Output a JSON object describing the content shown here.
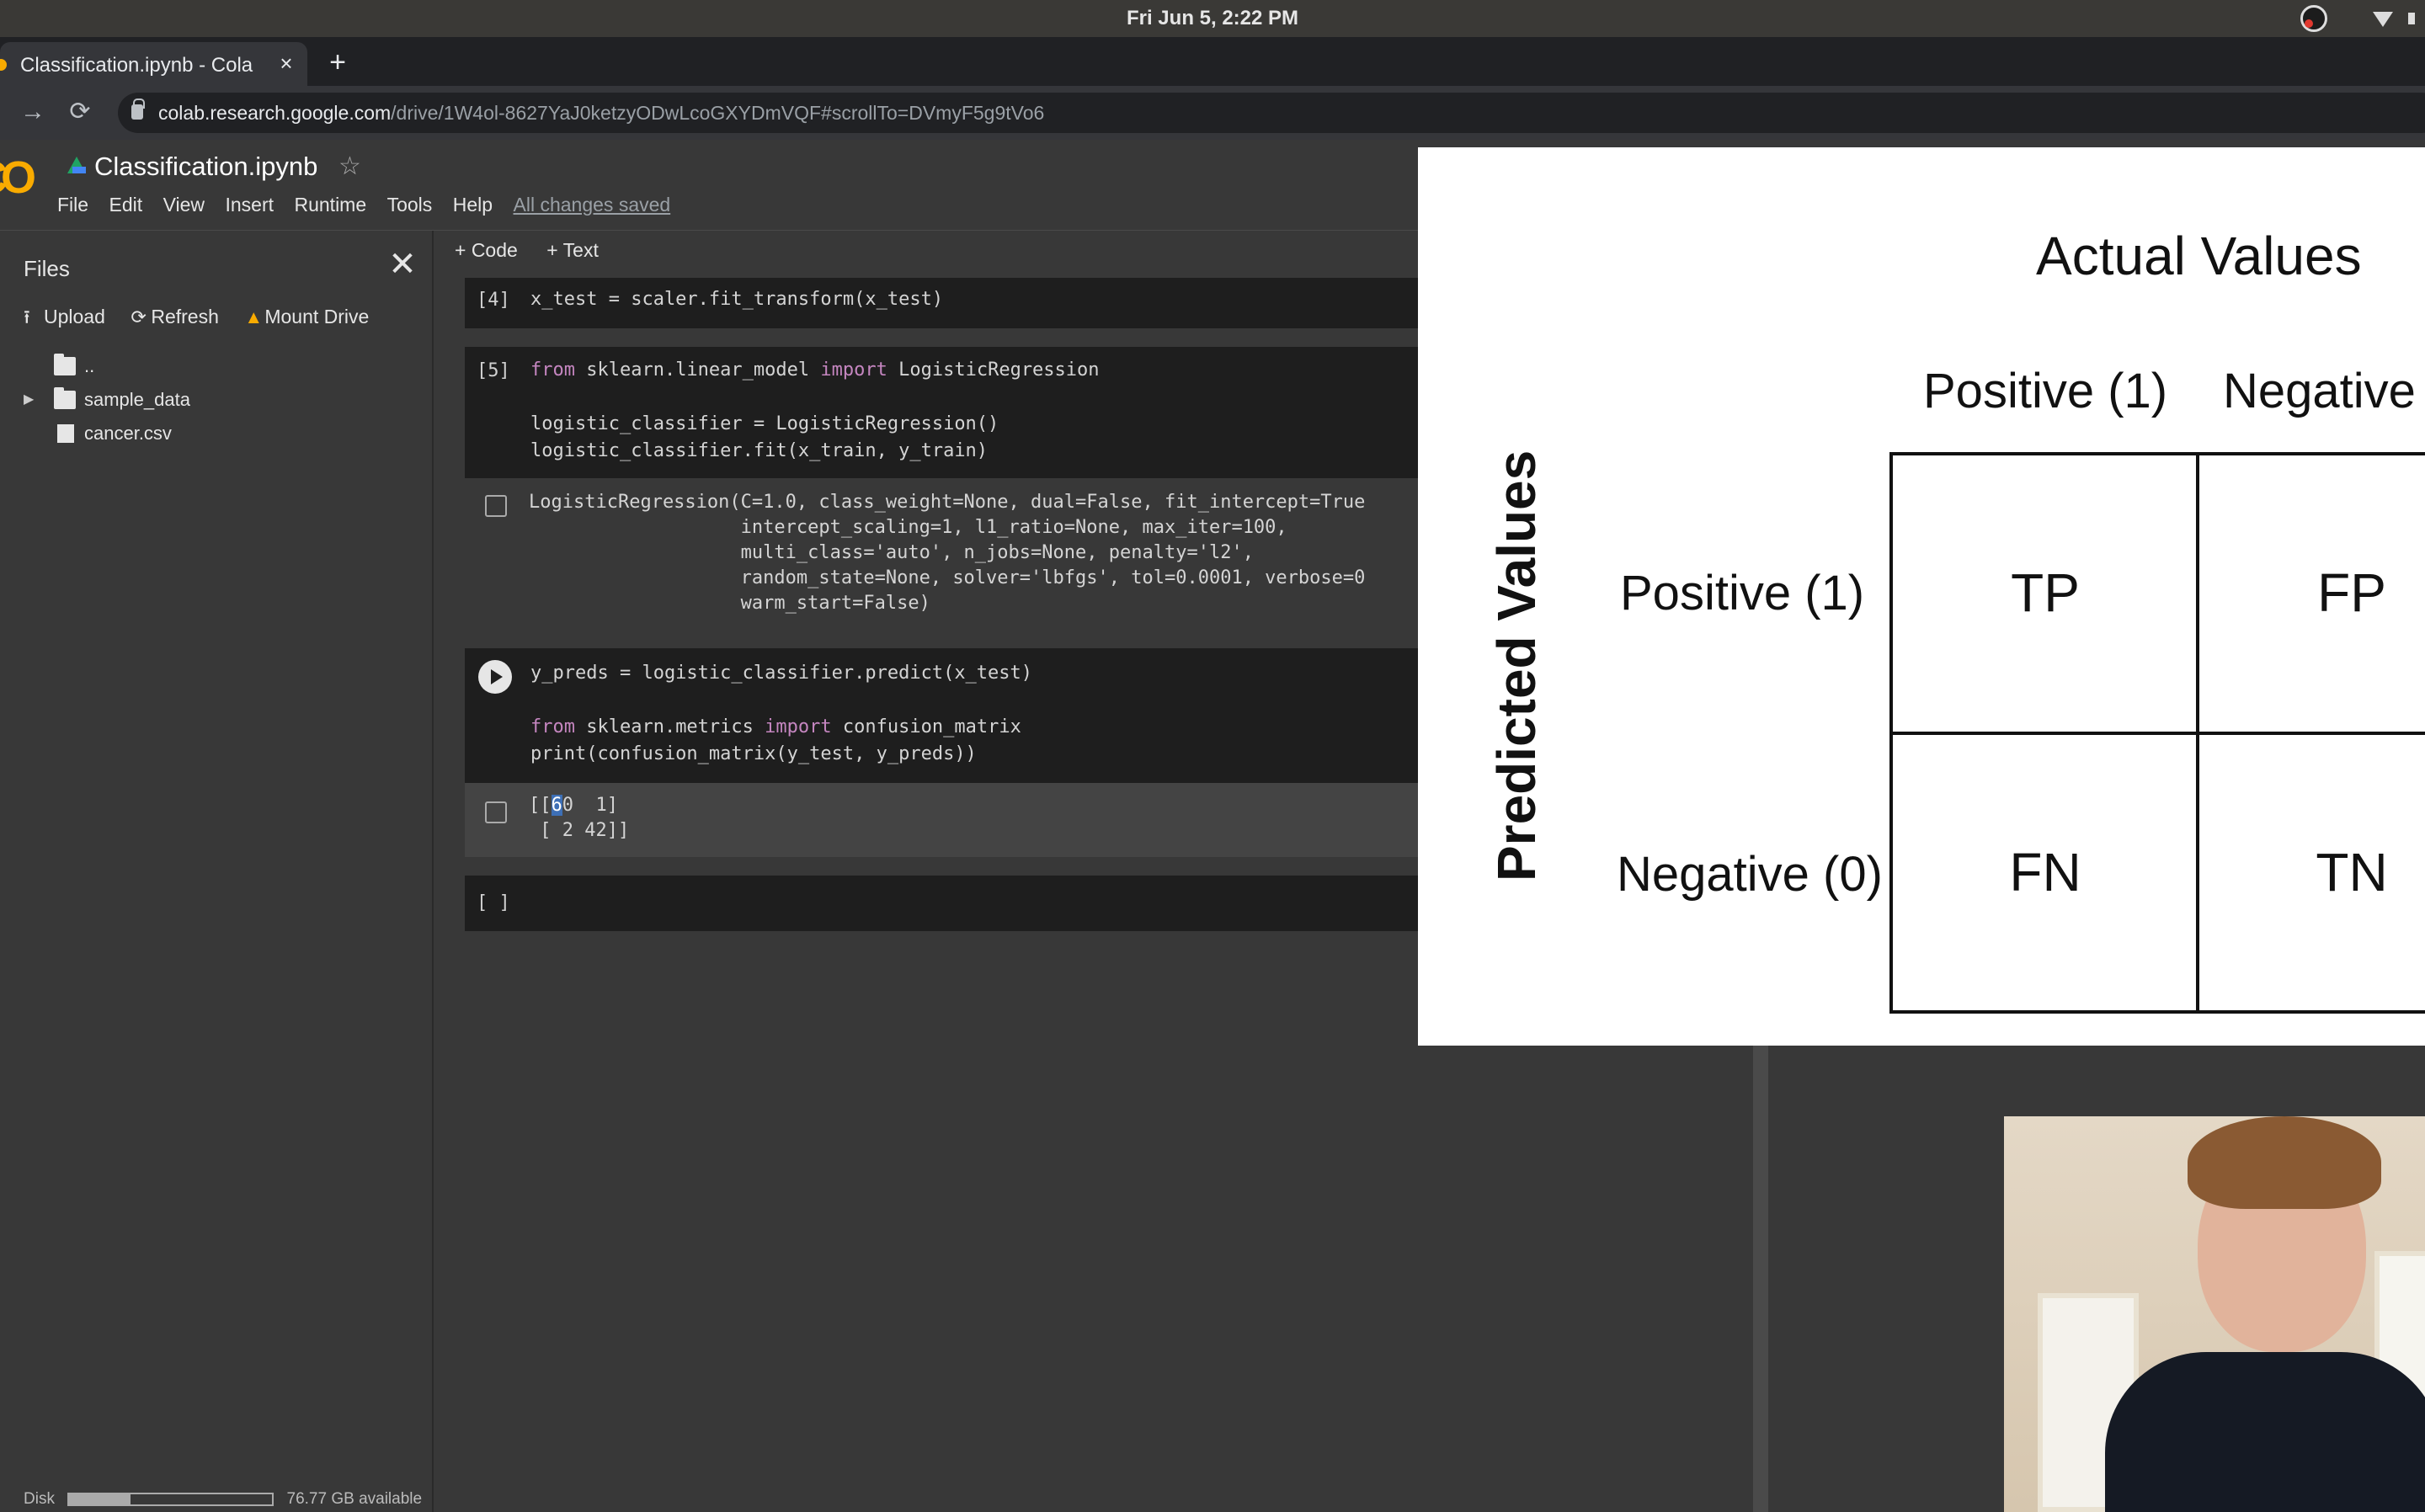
{
  "system_bar": {
    "clock": "Fri Jun  5,  2:22 PM"
  },
  "browser": {
    "tab_title": "Classification.ipynb - Cola",
    "tab_close": "×",
    "new_tab": "+",
    "url_host": "colab.research.google.com",
    "url_rest": "/drive/1W4ol-8627YaJ0ketzyODwLcoGXYDmVQF#scrollTo=DVmyF5g9tVo6"
  },
  "colab": {
    "logo": "CO",
    "notebook_title": "Classification.ipynb",
    "star": "☆",
    "menu": [
      "File",
      "Edit",
      "View",
      "Insert",
      "Runtime",
      "Tools",
      "Help"
    ],
    "save_status": "All changes saved"
  },
  "sidebar": {
    "title": "Files",
    "close": "✕",
    "actions": [
      {
        "icon": "upload-icon",
        "glyph": "⭱",
        "label": "Upload"
      },
      {
        "icon": "refresh-icon",
        "glyph": "⟳",
        "label": "Refresh"
      },
      {
        "icon": "drive-icon",
        "glyph": "▲",
        "label": "Mount Drive"
      }
    ],
    "tree": [
      {
        "label": "..",
        "kind": "folder-up"
      },
      {
        "label": "sample_data",
        "kind": "folder"
      },
      {
        "label": "cancer.csv",
        "kind": "file"
      }
    ],
    "disk_label": "Disk",
    "disk_available": "76.77 GB available",
    "disk_used_fraction": 0.3
  },
  "notebook": {
    "toolbar": {
      "add_code": "+ Code",
      "add_text": "+ Text"
    },
    "cell4": {
      "prompt": "[4]",
      "code": "x_test = scaler.fit_transform(x_test)"
    },
    "cell5": {
      "prompt": "[5]",
      "code_line1_kw1": "from",
      "code_line1_mod": " sklearn.linear_model ",
      "code_line1_kw2": "import",
      "code_line1_name": " LogisticRegression",
      "code_line2": "logistic_classifier = LogisticRegression()",
      "code_line3": "logistic_classifier.fit(x_train, y_train)",
      "output": "LogisticRegression(C=1.0, class_weight=None, dual=False, fit_intercept=True\n                   intercept_scaling=1, l1_ratio=None, max_iter=100,\n                   multi_class='auto', n_jobs=None, penalty='l2',\n                   random_state=None, solver='lbfgs', tol=0.0001, verbose=0\n                   warm_start=False)"
    },
    "cell6": {
      "code_line1": "y_preds = logistic_classifier.predict(x_test)",
      "code_line2_kw1": "from",
      "code_line2_mod": " sklearn.metrics ",
      "code_line2_kw2": "import",
      "code_line2_name": " confusion_matrix",
      "code_line3": "print(confusion_matrix(y_test, y_preds))",
      "output_pre": "[[",
      "output_sel": "6",
      "output_post": "0  1]\n [ 2 42]]"
    },
    "cell7": {
      "prompt": "[ ]"
    }
  },
  "slide": {
    "title": "Actual Values",
    "col_positive": "Positive (1)",
    "col_negative": "Negative",
    "row_positive": "Positive (1)",
    "row_negative": "Negative (0)",
    "y_label": "Predicted Values",
    "tp": "TP",
    "fp": "FP",
    "fn": "FN",
    "tn": "TN"
  }
}
